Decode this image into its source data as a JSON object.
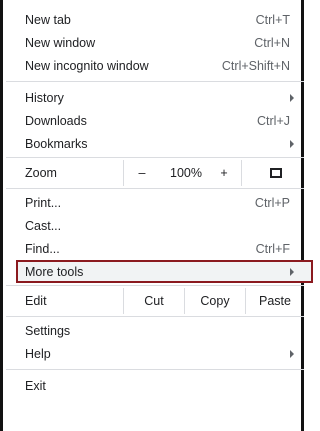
{
  "menu": {
    "new_tab": {
      "label": "New tab",
      "shortcut": "Ctrl+T"
    },
    "new_window": {
      "label": "New window",
      "shortcut": "Ctrl+N"
    },
    "new_incognito": {
      "label": "New incognito window",
      "shortcut": "Ctrl+Shift+N"
    },
    "history": {
      "label": "History"
    },
    "downloads": {
      "label": "Downloads",
      "shortcut": "Ctrl+J"
    },
    "bookmarks": {
      "label": "Bookmarks"
    },
    "zoom": {
      "label": "Zoom",
      "minus": "–",
      "level": "100%",
      "plus": "+",
      "icon": "fullscreen-icon"
    },
    "print": {
      "label": "Print...",
      "shortcut": "Ctrl+P"
    },
    "cast": {
      "label": "Cast..."
    },
    "find": {
      "label": "Find...",
      "shortcut": "Ctrl+F"
    },
    "more_tools": {
      "label": "More tools"
    },
    "edit": {
      "label": "Edit",
      "cut": "Cut",
      "copy": "Copy",
      "paste": "Paste"
    },
    "settings": {
      "label": "Settings"
    },
    "help": {
      "label": "Help"
    },
    "exit": {
      "label": "Exit"
    }
  },
  "colors": {
    "highlight_border": "#8b1a1f",
    "frame": "#111111",
    "separator": "#dadce0"
  }
}
